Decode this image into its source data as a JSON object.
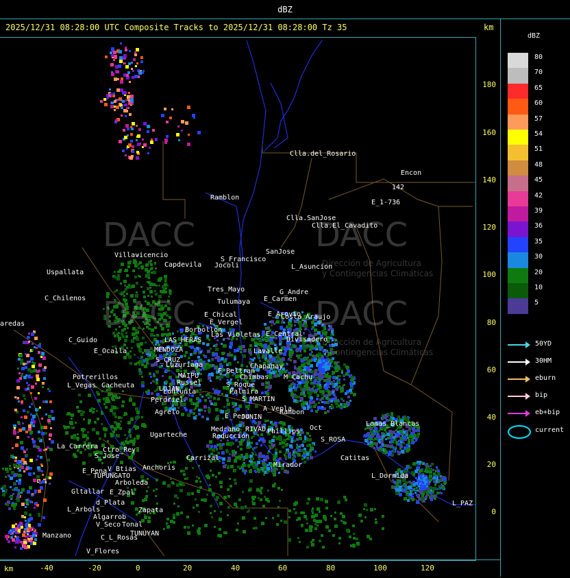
{
  "header": {
    "unit": "dBZ"
  },
  "subtitle": "2025/12/31 08:28:00 UTC Composite Tracks to 2025/12/31 08:28:00 Tz 35",
  "axis_unit": "km",
  "y_ticks": [
    "180",
    "160",
    "140",
    "120",
    "100",
    "80",
    "60",
    "40",
    "20",
    "0"
  ],
  "x_ticks": [
    "-40",
    "-20",
    "0",
    "20",
    "40",
    "60",
    "80",
    "100",
    "120"
  ],
  "legend": {
    "unit": "dBZ",
    "levels": [
      {
        "value": "80",
        "color": "#d9d9d9"
      },
      {
        "value": "70",
        "color": "#bdbdbd"
      },
      {
        "value": "65",
        "color": "#ff2b2b"
      },
      {
        "value": "60",
        "color": "#ff5a14"
      },
      {
        "value": "57",
        "color": "#ff9a5a"
      },
      {
        "value": "54",
        "color": "#ffff00"
      },
      {
        "value": "51",
        "color": "#f5c030"
      },
      {
        "value": "48",
        "color": "#d08c40"
      },
      {
        "value": "45",
        "color": "#c76e8a"
      },
      {
        "value": "42",
        "color": "#e83a96"
      },
      {
        "value": "39",
        "color": "#c01aa0"
      },
      {
        "value": "36",
        "color": "#7a14d0"
      },
      {
        "value": "35",
        "color": "#2244ff"
      },
      {
        "value": "30",
        "color": "#1a88e0"
      },
      {
        "value": "20",
        "color": "#0f7a0f"
      },
      {
        "value": "10",
        "color": "#0a5a0a"
      },
      {
        "value": "5",
        "color": "#4b3a96"
      }
    ]
  },
  "tracks": [
    {
      "label": "50YD",
      "color": "#4fd6e0"
    },
    {
      "label": "30HM",
      "color": "#ffffff"
    },
    {
      "label": "eburn",
      "color": "#f0c060"
    },
    {
      "label": "bip",
      "color": "#ffd0e0"
    },
    {
      "label": "eb+bip",
      "color": "#e040e0"
    }
  ],
  "current_label": "current",
  "watermark": {
    "brand": "DACC",
    "line1": "Dirección de Agricultura",
    "line2": "y Contingencias Climáticas"
  },
  "places": [
    "Clla.del_Rosario",
    "Encon",
    "142",
    "E_1-736",
    "Ramblon",
    "Clla.SanJose",
    "Clla.El_Cavadito",
    "Villavicencio",
    "Capdevila",
    "S_Francisco",
    "SanJose",
    "L_Asuncion",
    "Uspallata",
    "Jocoli",
    "Tres_Mayo",
    "G_Andre",
    "C_Chilenos",
    "Tulumaya",
    "E_Carmen",
    "E_Chical",
    "E_Arovio",
    "Costa_Araujo",
    "E_Vergel",
    "Borbollon",
    "Las_Violetas",
    "E_Central",
    "Divisadero",
    "aredas",
    "C_Guido",
    "LAS_HERAS",
    "E_Ocalla",
    "MENDOZA",
    "Lavalle",
    "S_CRUZ",
    "Chapanay",
    "Luzuriaga",
    "F_Beltran",
    "Potrerillos",
    "MAIPU",
    "Chimbas",
    "M_Cachu",
    "L_Vegas",
    "Cacheuta",
    "LUJAN",
    "Russel",
    "Palmira",
    "Lunlunta",
    "S_Roque",
    "Perdriel",
    "S_MARTIN",
    "Agrelo",
    "A_Vepla",
    "Rambon",
    "E_Pena",
    "JUNIN",
    "Ugarteche",
    "RIVAD",
    "Phillips",
    "Oct",
    "Lomas_Blancas",
    "Reduccion",
    "La_Carrera",
    "Medrano",
    "Ctro_Rey",
    "S_ROSA",
    "Carrizal",
    "Mirador",
    "Catitas",
    "E_Pena",
    "Anchoris",
    "S_Jose",
    "V_Btias",
    "TUPUNGATO",
    "L_Dormida",
    "Arboleda",
    "Gltallar",
    "E_Zpal",
    "L_PAZ",
    "d_Plata",
    "L_Arbols",
    "Zapata",
    "Algarrob",
    "V_Seco",
    "Tonal",
    "TUNUYAN",
    "Manzano",
    "C_L_Rosas",
    "V_Flores"
  ]
}
